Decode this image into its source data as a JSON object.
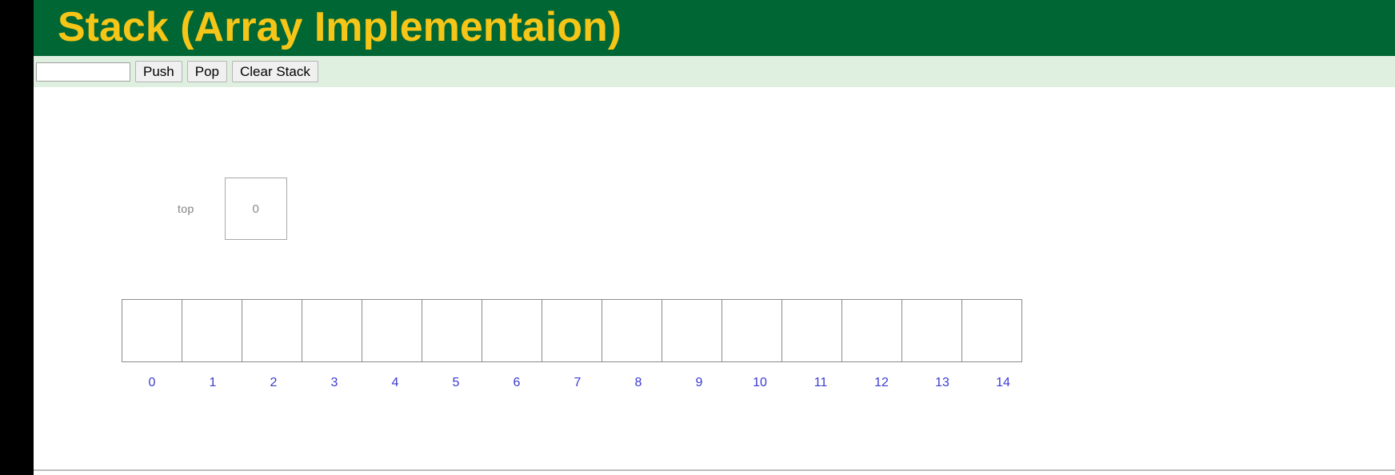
{
  "header": {
    "title": "Stack (Array Implementaion)",
    "background_color": "#006633",
    "title_color": "#f5c518"
  },
  "toolbar": {
    "background_color": "#dff0e0",
    "input": {
      "value": "",
      "placeholder": ""
    },
    "push_label": "Push",
    "pop_label": "Pop",
    "clear_label": "Clear Stack"
  },
  "visualization": {
    "top_pointer": {
      "label": "top",
      "value": "0",
      "label_color": "#808080",
      "value_color": "#8a8a8a"
    },
    "array": {
      "capacity": 15,
      "border_color": "#8c8c8c",
      "index_color": "#3b3bd1",
      "cells": [
        "",
        "",
        "",
        "",
        "",
        "",
        "",
        "",
        "",
        "",
        "",
        "",
        "",
        "",
        ""
      ],
      "indices": [
        "0",
        "1",
        "2",
        "3",
        "4",
        "5",
        "6",
        "7",
        "8",
        "9",
        "10",
        "11",
        "12",
        "13",
        "14"
      ]
    }
  },
  "chrome": {
    "left_rail_color": "#000000",
    "bottom_rule_color": "#bdbdbd"
  }
}
